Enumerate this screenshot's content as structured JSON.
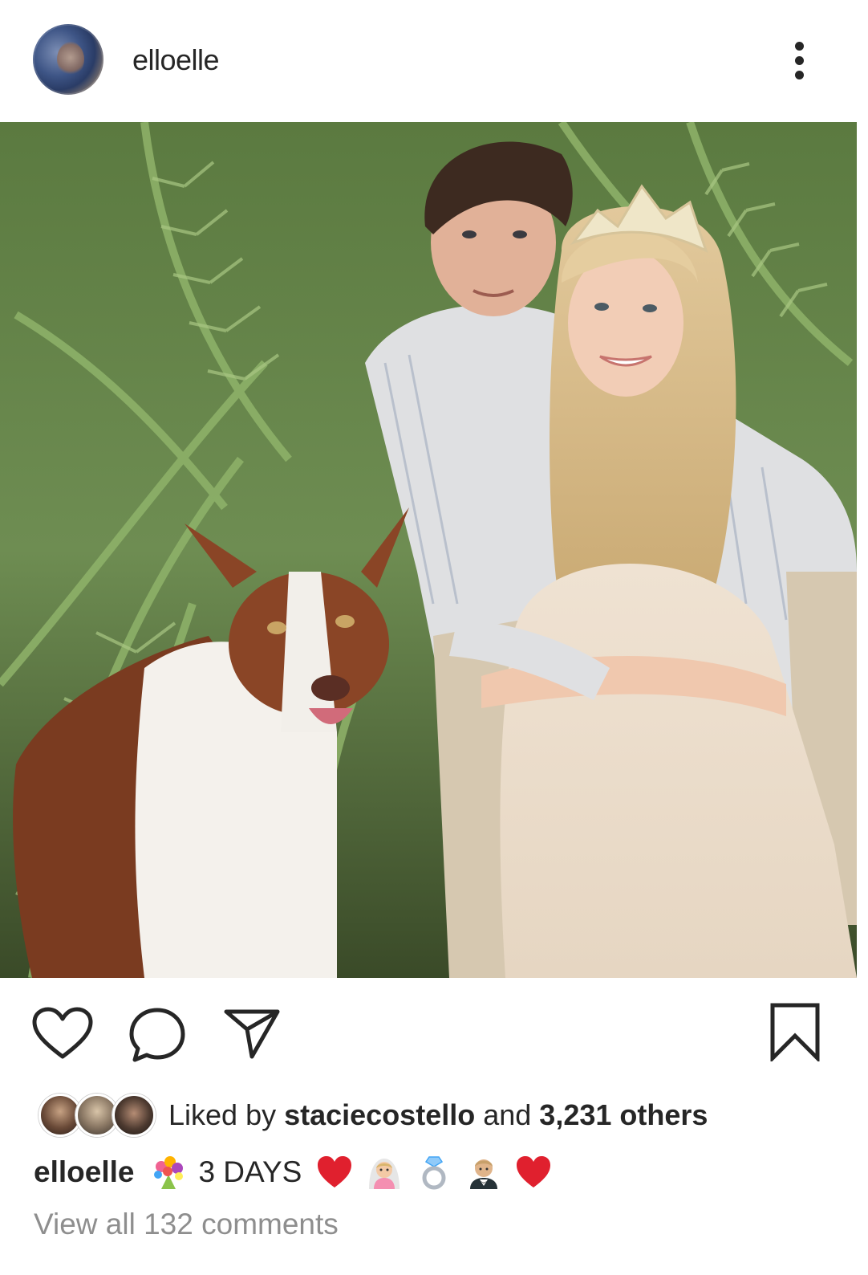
{
  "post": {
    "username": "elloelle",
    "photo_icon": "post-photo"
  },
  "likes": {
    "prefix": "Liked by ",
    "liker": "staciecostello",
    "middle": " and ",
    "others": "3,231 others"
  },
  "caption": {
    "username": "elloelle",
    "text": "3 DAYS",
    "emojis": [
      "bouquet-icon",
      "heart-icon",
      "bride-icon",
      "ring-icon",
      "groom-icon",
      "heart-icon"
    ]
  },
  "comments": {
    "view_all": "View all 132 comments"
  },
  "colors": {
    "text": "#262626",
    "muted": "#8e8e8e",
    "heart_red": "#e0202e"
  }
}
